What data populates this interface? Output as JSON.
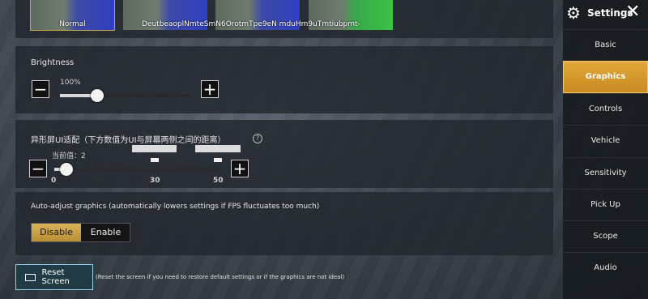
{
  "color_modes": [
    {
      "label": "Normal"
    },
    {
      "label": "Deuteranopia"
    },
    {
      "label": "Protanopia"
    },
    {
      "label": "Tritanopia"
    }
  ],
  "overlap_text": "DeutbeaoplNmteSmN6OrotmTpe9eN mduHm9uTmtiubpmt-",
  "brightness": {
    "label": "Brightness",
    "value_label": "100%",
    "value": 100
  },
  "screen_adapt": {
    "label": "异形屏UI适配（下方数值为UI与屏幕两侧之间的距离）",
    "current_label": "当前值：2",
    "current_value": 2,
    "min": 0,
    "max": 50,
    "tick_labels": [
      "0",
      "30",
      "50"
    ],
    "help": "?"
  },
  "auto_adjust": {
    "label": "Auto-adjust graphics (automatically lowers settings if FPS fluctuates too much)",
    "options": [
      "Disable",
      "Enable"
    ],
    "selected": "Disable"
  },
  "reset": {
    "label": "Reset Screen",
    "note": "(Reset the screen if you need to restore default settings or if the graphics are not ideal)"
  },
  "sidebar": {
    "title": "Settings",
    "items": [
      "Basic",
      "Graphics",
      "Controls",
      "Vehicle",
      "Sensitivity",
      "Pick Up",
      "Scope",
      "Audio"
    ],
    "active": "Graphics"
  }
}
